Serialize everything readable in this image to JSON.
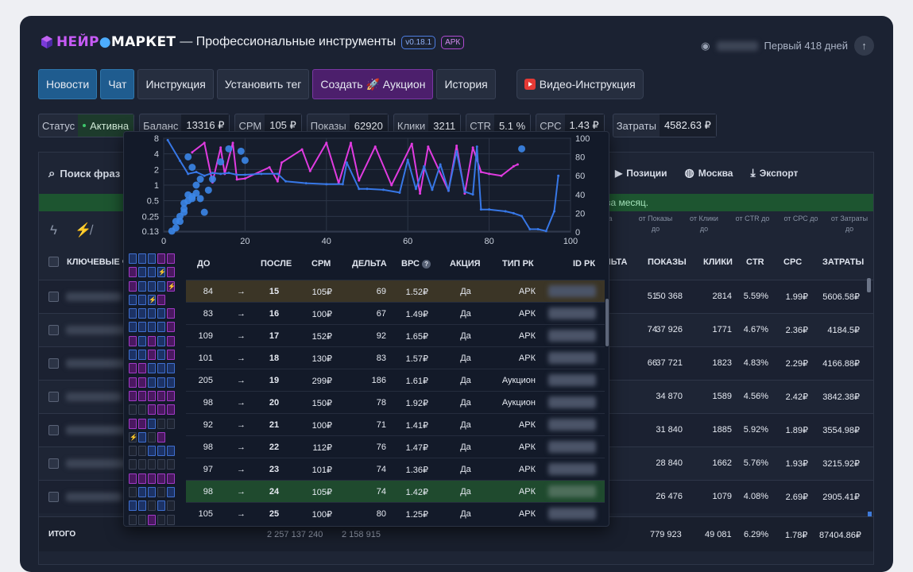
{
  "header": {
    "logo_part1": "НЕЙР",
    "logo_part2": "МАРКЕТ",
    "title": "— Профессиональные инструменты",
    "version": "v0.18.1",
    "badge": "АРК",
    "user_status": "Первый 418 дней"
  },
  "nav": {
    "news": "Новости",
    "chat": "Чат",
    "instructions": "Инструкция",
    "set_tag": "Установить тег",
    "create": "Создать 🚀 Аукцион",
    "history": "История",
    "video": "Видео-Инструкция"
  },
  "stats": [
    {
      "k": "Статус",
      "v": "Активна"
    },
    {
      "k": "Баланс",
      "v": "13316 ₽"
    },
    {
      "k": "СРМ",
      "v": "105 ₽"
    },
    {
      "k": "Показы",
      "v": "62920"
    },
    {
      "k": "Клики",
      "v": "3211"
    },
    {
      "k": "CTR",
      "v": "5.1 %"
    },
    {
      "k": "СРС",
      "v": "1.43 ₽"
    },
    {
      "k": "Затраты",
      "v": "4582.63 ₽"
    }
  ],
  "table": {
    "search_placeholder": "Поиск фраз",
    "tools": {
      "positions": "Позиции",
      "region": "Москва",
      "export": "Экспорт"
    },
    "notice": "за месяц.",
    "sub_headers": {
      "shows": "от Показы до",
      "clicks": "от Клики до",
      "ctr": "от CTR до",
      "cpc": "от СРС до",
      "cost": "от Затраты до",
      "delta_frag": "ьта"
    },
    "headers": {
      "keywords": "КЛЮЧЕВЫЕ ФР",
      "delta": "ЛЬТА",
      "shows": "ПОКАЗЫ",
      "clicks": "КЛИКИ",
      "ctr": "CTR",
      "cpc": "CPC",
      "cost": "ЗАТРАТЫ"
    },
    "rows": [
      {
        "delta": "51",
        "shows": "50 368",
        "clicks": "2814",
        "ctr": "5.59%",
        "cpc": "1.99₽",
        "cost": "5606.58₽"
      },
      {
        "delta": "74",
        "shows": "37 926",
        "clicks": "1771",
        "ctr": "4.67%",
        "cpc": "2.36₽",
        "cost": "4184.5₽"
      },
      {
        "delta": "66",
        "shows": "37 721",
        "clicks": "1823",
        "ctr": "4.83%",
        "cpc": "2.29₽",
        "cost": "4166.88₽"
      },
      {
        "delta": "",
        "shows": "34 870",
        "clicks": "1589",
        "ctr": "4.56%",
        "cpc": "2.42₽",
        "cost": "3842.38₽"
      },
      {
        "delta": "",
        "shows": "31 840",
        "clicks": "1885",
        "ctr": "5.92%",
        "cpc": "1.89₽",
        "cost": "3554.98₽"
      },
      {
        "delta": "",
        "shows": "28 840",
        "clicks": "1662",
        "ctr": "5.76%",
        "cpc": "1.93₽",
        "cost": "3215.92₽"
      },
      {
        "delta": "",
        "shows": "26 476",
        "clicks": "1079",
        "ctr": "4.08%",
        "cpc": "2.69₽",
        "cost": "2905.41₽"
      }
    ],
    "total": {
      "label": "ИТОГО",
      "sum1": "2 257 137 240",
      "sum2": "2 158 915",
      "shows": "779 923",
      "clicks": "49 081",
      "ctr": "6.29%",
      "cpc": "1.78₽",
      "cost": "87404.86₽"
    }
  },
  "overlay": {
    "headers": {
      "before": "ДО",
      "after": "ПОСЛЕ",
      "cpm": "СРМ",
      "delta": "ДЕЛЬТА",
      "bps": "ВРС",
      "promo": "АКЦИЯ",
      "type": "ТИП РК",
      "id": "ID РК"
    },
    "help": "?",
    "arrow": "→",
    "rows": [
      {
        "before": "84",
        "after": "15",
        "cpm": "105₽",
        "delta": "69",
        "bps": "1.52₽",
        "promo": "Да",
        "type": "АРК"
      },
      {
        "before": "83",
        "after": "16",
        "cpm": "100₽",
        "delta": "67",
        "bps": "1.49₽",
        "promo": "Да",
        "type": "АРК"
      },
      {
        "before": "109",
        "after": "17",
        "cpm": "152₽",
        "delta": "92",
        "bps": "1.65₽",
        "promo": "Да",
        "type": "АРК"
      },
      {
        "before": "101",
        "after": "18",
        "cpm": "130₽",
        "delta": "83",
        "bps": "1.57₽",
        "promo": "Да",
        "type": "АРК"
      },
      {
        "before": "205",
        "after": "19",
        "cpm": "299₽",
        "delta": "186",
        "bps": "1.61₽",
        "promo": "Да",
        "type": "Аукцион"
      },
      {
        "before": "98",
        "after": "20",
        "cpm": "150₽",
        "delta": "78",
        "bps": "1.92₽",
        "promo": "Да",
        "type": "Аукцион"
      },
      {
        "before": "92",
        "after": "21",
        "cpm": "100₽",
        "delta": "71",
        "bps": "1.41₽",
        "promo": "Да",
        "type": "АРК"
      },
      {
        "before": "98",
        "after": "22",
        "cpm": "112₽",
        "delta": "76",
        "bps": "1.47₽",
        "promo": "Да",
        "type": "АРК"
      },
      {
        "before": "97",
        "after": "23",
        "cpm": "101₽",
        "delta": "74",
        "bps": "1.36₽",
        "promo": "Да",
        "type": "АРК"
      },
      {
        "before": "98",
        "after": "24",
        "cpm": "105₽",
        "delta": "74",
        "bps": "1.42₽",
        "promo": "Да",
        "type": "АРК"
      },
      {
        "before": "105",
        "after": "25",
        "cpm": "100₽",
        "delta": "80",
        "bps": "1.25₽",
        "promo": "Да",
        "type": "АРК"
      }
    ],
    "squares": [
      "bbbmm",
      "mbbb⚡m",
      "mbbbm⚡",
      "bbb⚡m",
      "bbbbm",
      "bbbbm",
      "mbmbm",
      "bbmbm",
      "mmbbb",
      "mmbbb",
      "mmmmm",
      "ddmmm",
      "mmbdd",
      "d⚡bdm",
      "ddbbb",
      "ddddd",
      "mmmmm",
      "dbbdb",
      "bbdbd",
      "ddmdd",
      "mbbd⚡",
      "dbddm",
      "bbddd"
    ]
  },
  "chart_data": {
    "type": "line",
    "xlim": [
      0,
      100
    ],
    "x_ticks": [
      "0",
      "20",
      "40",
      "60",
      "80",
      "100"
    ],
    "y_left_ticks": [
      "8",
      "4",
      "2",
      "1",
      "0.5",
      "0.25",
      "0.13"
    ],
    "y_right_ticks": [
      "100",
      "80",
      "60",
      "40",
      "20",
      "0"
    ],
    "series": [
      {
        "axis": "right",
        "color": "#e03be0",
        "x": [
          7,
          10,
          12,
          14,
          15,
          17,
          18,
          20,
          26,
          28,
          29,
          34,
          36,
          40,
          43,
          46,
          48,
          52,
          56,
          61,
          63,
          65,
          70,
          72,
          74,
          76,
          78,
          80,
          83,
          86,
          87
        ],
        "y": [
          85,
          95,
          53,
          90,
          62,
          95,
          56,
          57,
          69,
          54,
          74,
          88,
          65,
          95,
          52,
          95,
          55,
          91,
          50,
          94,
          41,
          91,
          44,
          92,
          41,
          90,
          64,
          62,
          60,
          70,
          72
        ]
      },
      {
        "axis": "right",
        "color": "#3777e6",
        "x": [
          1,
          4,
          6,
          8,
          10,
          12,
          14,
          16,
          18,
          20,
          24,
          28,
          30,
          35,
          40,
          44,
          45,
          48,
          50,
          54,
          58,
          60,
          62,
          64,
          66,
          68,
          70,
          72,
          74,
          76,
          77,
          78,
          80,
          84,
          86,
          88,
          90,
          92,
          94,
          96,
          97
        ],
        "y": [
          98,
          76,
          62,
          64,
          60,
          63,
          62,
          63,
          61,
          61,
          62,
          62,
          54,
          52,
          51,
          51,
          74,
          46,
          46,
          45,
          42,
          77,
          46,
          70,
          45,
          72,
          44,
          86,
          43,
          40,
          91,
          24,
          24,
          22,
          20,
          17,
          3,
          3,
          1,
          22,
          60
        ]
      },
      {
        "axis": "left",
        "type": "scatter",
        "color": "#3b86e8",
        "x": [
          2,
          3,
          3,
          4,
          4,
          5,
          5,
          5,
          6,
          6,
          6,
          7,
          7,
          7,
          8,
          8,
          9,
          9,
          10,
          11,
          12,
          14,
          16,
          19,
          20,
          88
        ],
        "y": [
          0.13,
          0.15,
          0.2,
          0.2,
          0.25,
          0.3,
          0.35,
          0.45,
          0.5,
          0.65,
          3.5,
          0.55,
          0.6,
          2.2,
          1,
          0.7,
          1.3,
          0.55,
          0.3,
          0.8,
          1.3,
          2.8,
          5,
          4.5,
          3,
          5
        ]
      }
    ]
  }
}
